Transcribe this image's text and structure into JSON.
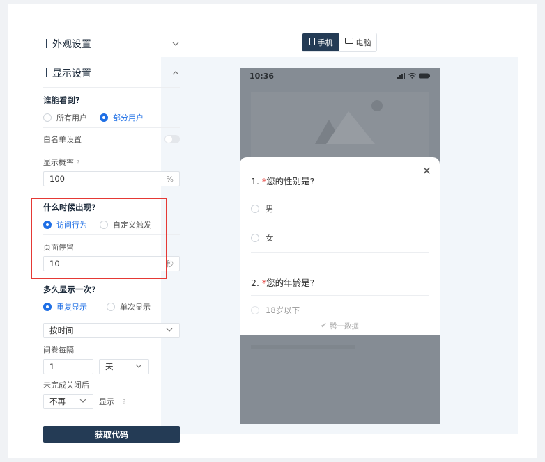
{
  "left_panel": {
    "appearance_title": "外观设置",
    "display_title": "显示设置",
    "who_title": "谁能看到?",
    "who_options": [
      "所有用户",
      "部分用户"
    ],
    "whitelist_label": "白名单设置",
    "probability_label": "显示概率",
    "probability_value": "100",
    "probability_suffix": "%",
    "when_title": "什么时候出现?",
    "when_options": [
      "访问行为",
      "自定义触发"
    ],
    "stay_label": "页面停留",
    "stay_value": "10",
    "stay_suffix": "秒",
    "freq_title": "多久显示一次?",
    "freq_options": [
      "重复显示",
      "单次显示"
    ],
    "by_time": "按时间",
    "interval_label": "问卷每隔",
    "interval_value": "1",
    "interval_unit": "天",
    "unfinished_label": "未完成关闭后",
    "unfinished_value": "不再",
    "unfinished_suffix": "显示",
    "get_code": "获取代码"
  },
  "preview": {
    "tab_mobile": "手机",
    "tab_desktop": "电脑",
    "time": "10:36",
    "q1_num": "1.",
    "q1_star": "*",
    "q1_text": "您的性别是?",
    "q1_opts": [
      "男",
      "女"
    ],
    "q2_num": "2.",
    "q2_star": "*",
    "q2_text": "您的年龄是?",
    "q2_opt_partial": "18岁以下",
    "footer": "腾一数据"
  },
  "colors": {
    "accent": "#1f6fe5",
    "dark": "#243b55",
    "highlight": "#e53935"
  }
}
